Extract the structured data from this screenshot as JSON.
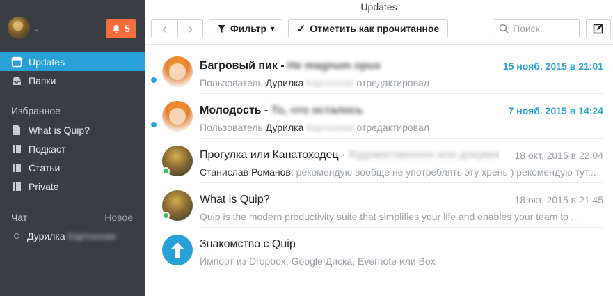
{
  "app": {
    "title": "Updates"
  },
  "sidebar": {
    "notification_count": "5",
    "nav": [
      {
        "label": "Updates",
        "icon": "updates-icon"
      },
      {
        "label": "Папки",
        "icon": "inbox-icon"
      }
    ],
    "favorites_title": "Избранное",
    "favorites": [
      {
        "label": "What is Quip?",
        "icon": "document-icon"
      },
      {
        "label": "Подкаст",
        "icon": "folder-icon"
      },
      {
        "label": "Статьи",
        "icon": "folder-icon"
      },
      {
        "label": "Private",
        "icon": "folder-icon"
      }
    ],
    "chat_title": "Чат",
    "chat_new": "Новое",
    "chat_user_first": "Дурилка",
    "chat_user_last": "Картонная"
  },
  "toolbar": {
    "back": "‹",
    "forward": "›",
    "filter_label": "Фильтр",
    "mark_read_label": "Отметить как прочитанное",
    "search_placeholder": "Поиск"
  },
  "updates": [
    {
      "title": "Багровый пик",
      "title_sep": " - ",
      "title_extra": "Не magnum opus",
      "sub_prefix": "Пользователь ",
      "sub_who": "Дурилка",
      "sub_blur": " Картонная",
      "sub_suffix": " отредактировал",
      "date": "15 нояб. 2015 в 21:01",
      "unread": true
    },
    {
      "title": "Молодость",
      "title_sep": " - ",
      "title_extra": "То, что осталось",
      "sub_prefix": "Пользователь ",
      "sub_who": "Дурилка",
      "sub_blur": " Картонная",
      "sub_suffix": " отредактировал",
      "date": "7 нояб. 2015 в 14:24",
      "unread": true
    },
    {
      "title": "Прогулка или Канатоходец",
      "title_sep": " · ",
      "title_extra": "Художественное или документальное",
      "sub_who": "Станислав Романов:",
      "sub_text": " рекомендую вообще не употреблять эту хрень ) рекомендую тут...",
      "date": "18 окт. 2015 в 22:04",
      "unread": false
    },
    {
      "title": "What is Quip?",
      "sub_text": "Quip is the modern productivity suite that simplifies your life and enables your team to ...",
      "date": "18 окт. 2015 в 21:45",
      "unread": false
    },
    {
      "title": "Знакомство с Quip",
      "sub_text": "Импорт из Dropbox, Google Диска, Evernote или Box",
      "unread": false
    }
  ],
  "colors": {
    "accent": "#28a0d8",
    "sidebar": "#3a3e44",
    "notification": "#f36d3d",
    "online": "#3bc15a"
  }
}
